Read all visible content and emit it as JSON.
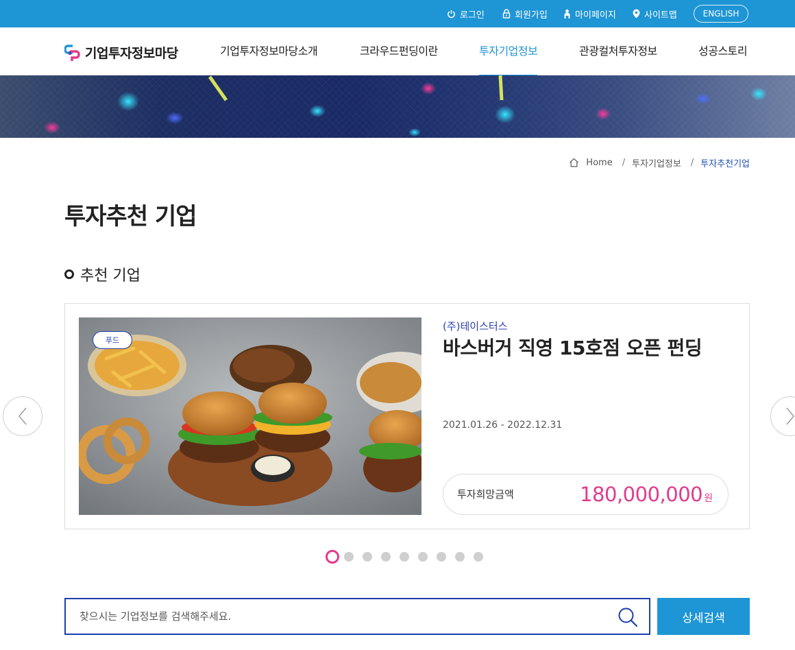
{
  "topbar": {
    "login": "로그인",
    "signup": "회원가입",
    "mypage": "마이페이지",
    "sitemap": "사이트맵",
    "english": "ENGLISH"
  },
  "header": {
    "logo_text": "기업투자정보마당",
    "nav": [
      {
        "label": "기업투자정보마당소개"
      },
      {
        "label": "크라우드펀딩이란"
      },
      {
        "label": "투자기업정보"
      },
      {
        "label": "관광컬처투자정보"
      },
      {
        "label": "성공스토리"
      }
    ]
  },
  "breadcrumb": {
    "home": "Home",
    "level1": "투자기업정보",
    "current": "투자추천기업"
  },
  "page_title": "투자추천 기업",
  "section_title": "추천 기업",
  "card": {
    "tag": "푸드",
    "company": "(주)테이스터스",
    "title": "바스버거 직영 15호점 오픈 펀딩",
    "period": "2021.01.26 - 2022.12.31",
    "amount_label": "투자희망금액",
    "amount_value": "180,000,000",
    "amount_unit": "원"
  },
  "slider": {
    "total": 9,
    "active": 1
  },
  "search": {
    "placeholder": "찾으시는 기업정보를 검색해주세요.",
    "value": "",
    "button": "상세검색"
  },
  "colors": {
    "primary": "#1e95d4",
    "navy": "#1e3fae",
    "accent": "#e23a8c"
  }
}
